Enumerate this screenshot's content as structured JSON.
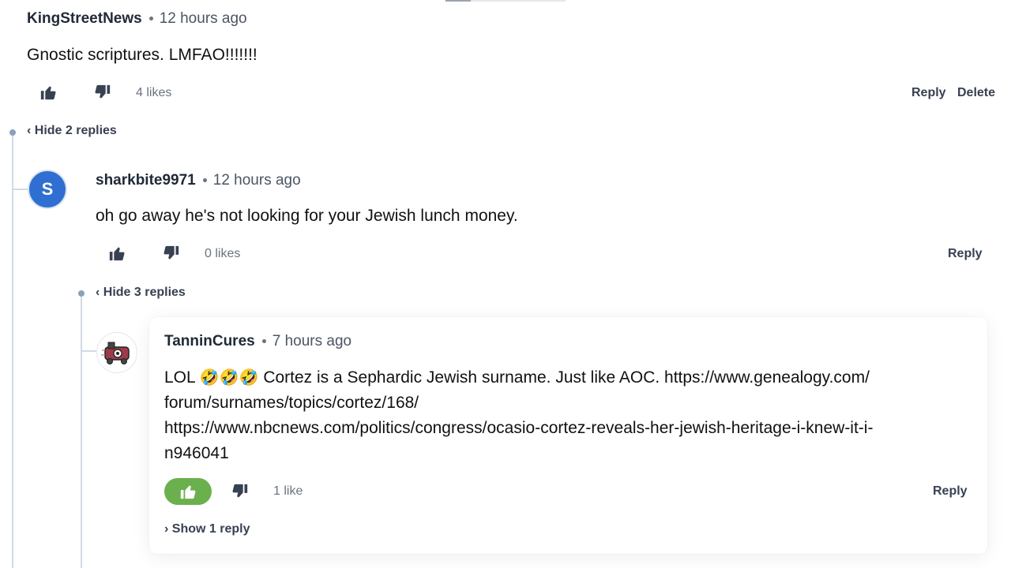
{
  "comment1": {
    "username": "KingStreetNews",
    "time": "12 hours ago",
    "text": "Gnostic scriptures. LMFAO!!!!!!!",
    "likes": "4 likes",
    "reply_label": "Reply",
    "delete_label": "Delete",
    "toggle_replies": "‹ Hide 2 replies"
  },
  "comment2": {
    "avatar_letter": "S",
    "username": "sharkbite9971",
    "time": "12 hours ago",
    "text": "oh go away he's not looking for your Jewish lunch money.",
    "likes": "0 likes",
    "reply_label": "Reply",
    "toggle_replies": "‹ Hide 3 replies"
  },
  "comment3": {
    "username": "TanninCures",
    "time": "7 hours ago",
    "text_prefix": "LOL",
    "emojis": "🤣🤣🤣",
    "text_line1": "Cortez is a Sephardic Jewish surname. Just like AOC. https://www.genealogy.com/",
    "text_line2": "forum/surnames/topics/cortez/168/",
    "text_line3": "https://www.nbcnews.com/politics/congress/ocasio-cortez-reveals-her-jewish-heritage-i-knew-it-i-",
    "text_line4": "n946041",
    "likes": "1 like",
    "reply_label": "Reply",
    "toggle_replies": "› Show 1 reply",
    "like_active_color": "#6ab04c"
  },
  "colors": {
    "thread_line": "#d1dae6",
    "thread_node": "#8aa1bb",
    "avatar_blue": "#2f6fd1"
  }
}
